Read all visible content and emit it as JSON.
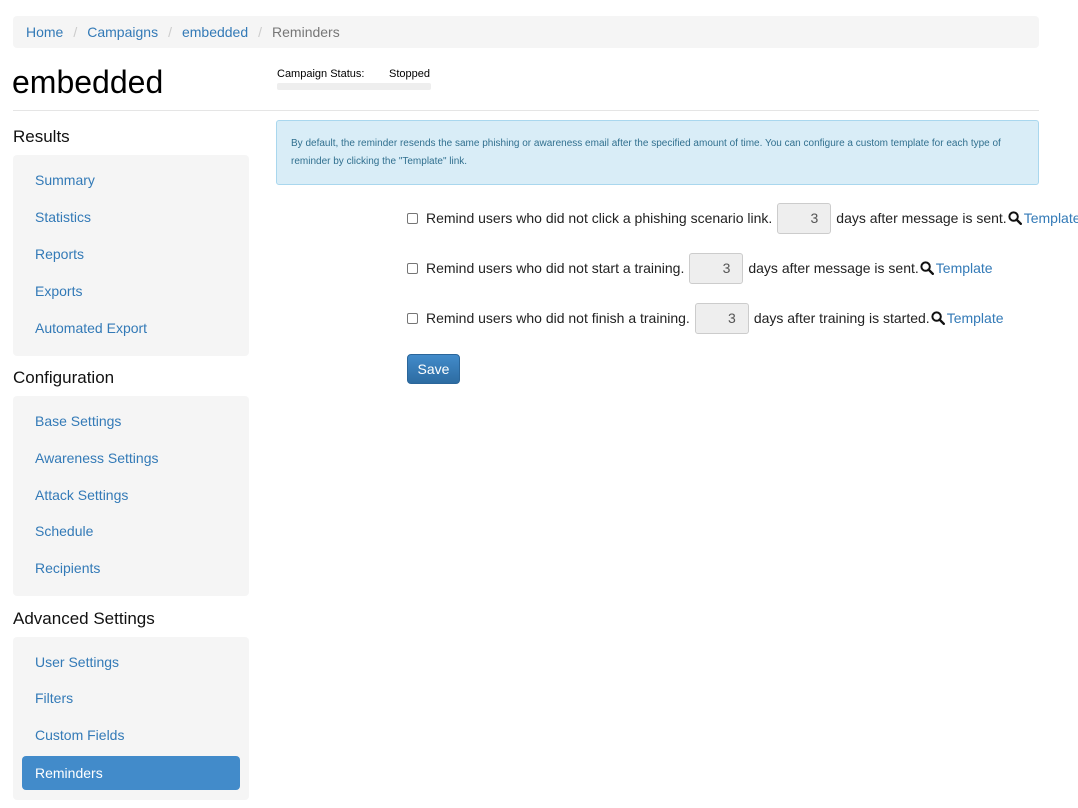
{
  "breadcrumb": {
    "items": [
      "Home",
      "Campaigns",
      "embedded"
    ],
    "current": "Reminders",
    "separator": "/"
  },
  "page_title": "embedded",
  "campaign_status": {
    "label": "Campaign Status:",
    "value": "Stopped"
  },
  "sidebar": {
    "results": {
      "heading": "Results",
      "items": [
        "Summary",
        "Statistics",
        "Reports",
        "Exports",
        "Automated Export"
      ]
    },
    "configuration": {
      "heading": "Configuration",
      "items": [
        "Base Settings",
        "Awareness Settings",
        "Attack Settings",
        "Schedule",
        "Recipients"
      ]
    },
    "advanced": {
      "heading": "Advanced Settings",
      "items": [
        "User Settings",
        "Filters",
        "Custom Fields",
        "Reminders"
      ],
      "active": "Reminders"
    }
  },
  "info_text": "By default, the reminder resends the same phishing or awareness email after the specified amount of time. You can configure a custom template for each type of reminder by clicking the \"Template\" link.",
  "reminders": [
    {
      "label": "Remind users who did not click a phishing scenario link.",
      "days": "3",
      "suffix": "days after message is sent.",
      "link": "Template",
      "checked": false
    },
    {
      "label": "Remind users who did not start a training.",
      "days": "3",
      "suffix": "days after message is sent.",
      "link": "Template",
      "checked": false
    },
    {
      "label": "Remind users who did not finish a training.",
      "days": "3",
      "suffix": "days after training is started.",
      "link": "Template",
      "checked": false
    }
  ],
  "save_label": "Save",
  "colors": {
    "link": "#337ab7",
    "active_nav": "#428bca",
    "alert_bg": "#d9edf7",
    "alert_text": "#31708f"
  }
}
